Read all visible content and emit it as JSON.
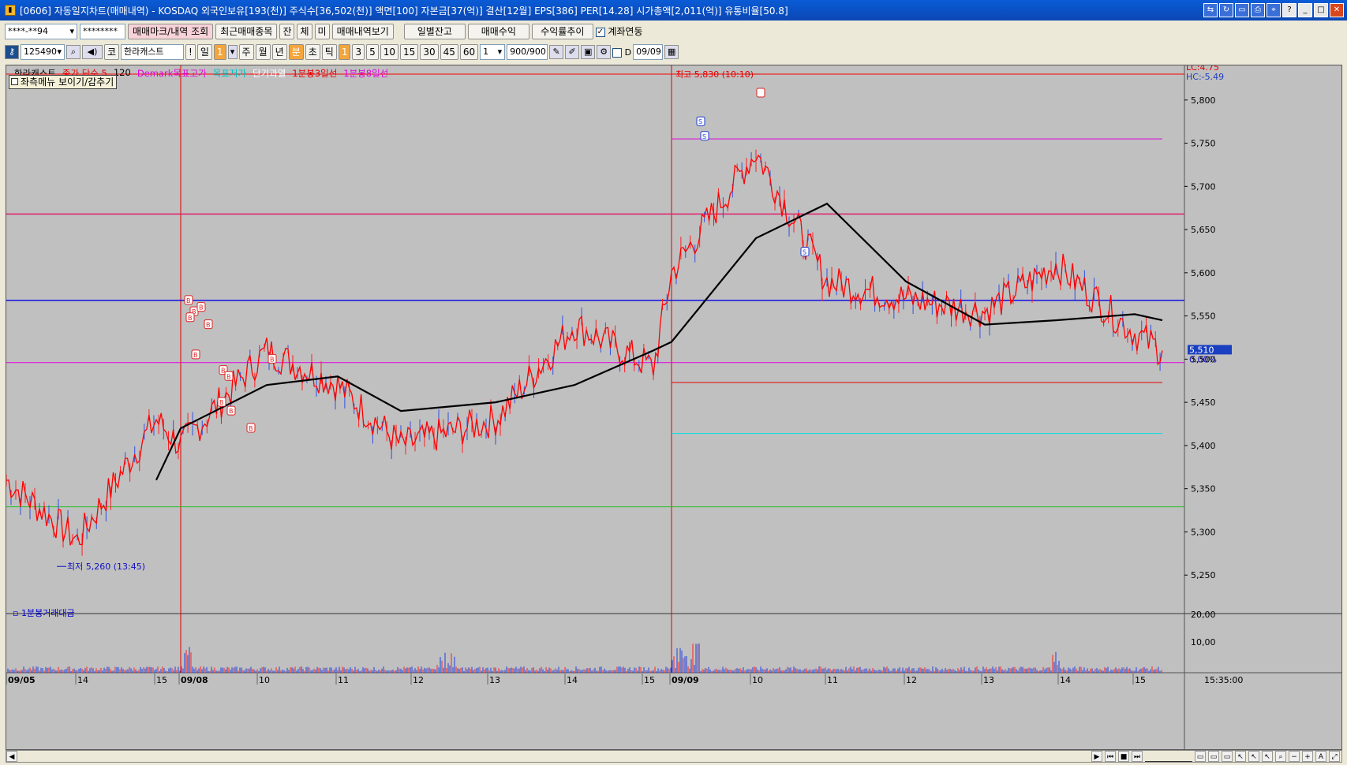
{
  "window": {
    "icon": "chart-app-icon",
    "title": "[0606] 자동일지차트(매매내역) - KOSDAQ 외국인보유[193(천)] 주식수[36,502(천)] 액면[100] 자본금[37(억)] 결산[12월] EPS[386] PER[14.28] 시가총액[2,011(억)] 유통비율[50.8]"
  },
  "toolbar1": {
    "account": "****-**94",
    "password": "********",
    "btn_trade_mark": "매매마크/내역 조회",
    "btn_recent": "최근매매종목",
    "btn_jan": "잔",
    "btn_che": "체",
    "btn_mi": "미",
    "btn_history": "매매내역보기",
    "btn_daily_balance": "일별잔고",
    "btn_trade_profit": "매매수익",
    "btn_return_trend": "수익률추이",
    "account_link_label": "계좌연동",
    "account_link_checked": true
  },
  "toolbar2": {
    "code": "125490",
    "code_prefix": "코",
    "stock_name": "한라캐스트",
    "excl": "!",
    "period_day": "일",
    "period_num": "1",
    "week": "주",
    "month": "월",
    "year": "년",
    "minute": "분",
    "second": "초",
    "tick": "틱",
    "intervals": [
      "1",
      "3",
      "5",
      "10",
      "15",
      "30",
      "45",
      "60"
    ],
    "multiplier": "1",
    "count": "900/900",
    "date_check_label": "D",
    "date": "09/09"
  },
  "chart": {
    "legend": [
      {
        "text": "한라캐스트",
        "color": "#000000"
      },
      {
        "text": "종가 단순 5",
        "color": "#e00000"
      },
      {
        "text": "120",
        "color": "#000000"
      },
      {
        "text": "Demark목표고가",
        "color": "#e000e0"
      },
      {
        "text": "목표저가",
        "color": "#00c0c0"
      },
      {
        "text": "단기과열",
        "color": "#ffffff"
      },
      {
        "text": "1분봉3일선",
        "color": "#e00000"
      },
      {
        "text": "1분봉8일선",
        "color": "#e000e0"
      }
    ],
    "menu_toggle": "좌측메뉴 보이기/감추기",
    "lc_label": "LC:4.75",
    "hc_label": "HC:-5.49",
    "high_label": "최고 5,830 (10:10)",
    "low_label": "최저 5,260 (13:45)",
    "current_price": "5,510",
    "current_pct": "0.00%",
    "y_ticks": [
      "5,800",
      "5,750",
      "5,700",
      "5,650",
      "5,600",
      "5,550",
      "5,500",
      "5,450",
      "5,400",
      "5,350",
      "5,300",
      "5,250"
    ],
    "volume_label": "1분봉거래대금",
    "volume_ticks": [
      "20,00",
      "10,00"
    ],
    "x_labels": [
      "09/05",
      "14",
      "15",
      "09/08",
      "10",
      "11",
      "12",
      "13",
      "14",
      "15",
      "09/09",
      "10",
      "11",
      "12",
      "13",
      "14",
      "15"
    ],
    "time_label": "15:35:00",
    "colors": {
      "price_line": "#ff0000",
      "ma120": "#000000",
      "buy_marker": "#dd2222",
      "sell_marker": "#1c3cd0"
    }
  },
  "chart_data": {
    "type": "line",
    "title": "",
    "xlabel": "",
    "ylabel": "",
    "ylim": [
      5210,
      5840
    ],
    "x": [
      "09/05 13:30",
      "09/05 14:00",
      "09/05 15:00",
      "09/08 09:00",
      "09/08 10:00",
      "09/08 11:00",
      "09/08 12:00",
      "09/08 13:00",
      "09/08 14:00",
      "09/08 15:00",
      "09/09 09:00",
      "09/09 10:00",
      "09/09 11:00",
      "09/09 12:00",
      "09/09 13:00",
      "09/09 14:00",
      "09/09 15:00",
      "09/09 15:20"
    ],
    "series": [
      {
        "name": "종가 단순 5",
        "values": [
          5360,
          5290,
          5430,
          5400,
          5510,
          5470,
          5400,
          5430,
          5540,
          5490,
          5600,
          5740,
          5590,
          5570,
          5555,
          5610,
          5530,
          5510
        ]
      },
      {
        "name": "120",
        "values": [
          null,
          null,
          5360,
          5420,
          5470,
          5480,
          5440,
          5450,
          5470,
          5510,
          5520,
          5640,
          5680,
          5590,
          5540,
          5545,
          5552,
          5545
        ]
      }
    ],
    "horizontal_lines": [
      5830,
      5755,
      5668,
      5568,
      5496,
      5473,
      5414,
      5329
    ],
    "high": {
      "value": 5830,
      "time": "10:10"
    },
    "low": {
      "value": 5260,
      "time": "13:45"
    },
    "buy_markers": 12,
    "sell_markers": 3
  }
}
